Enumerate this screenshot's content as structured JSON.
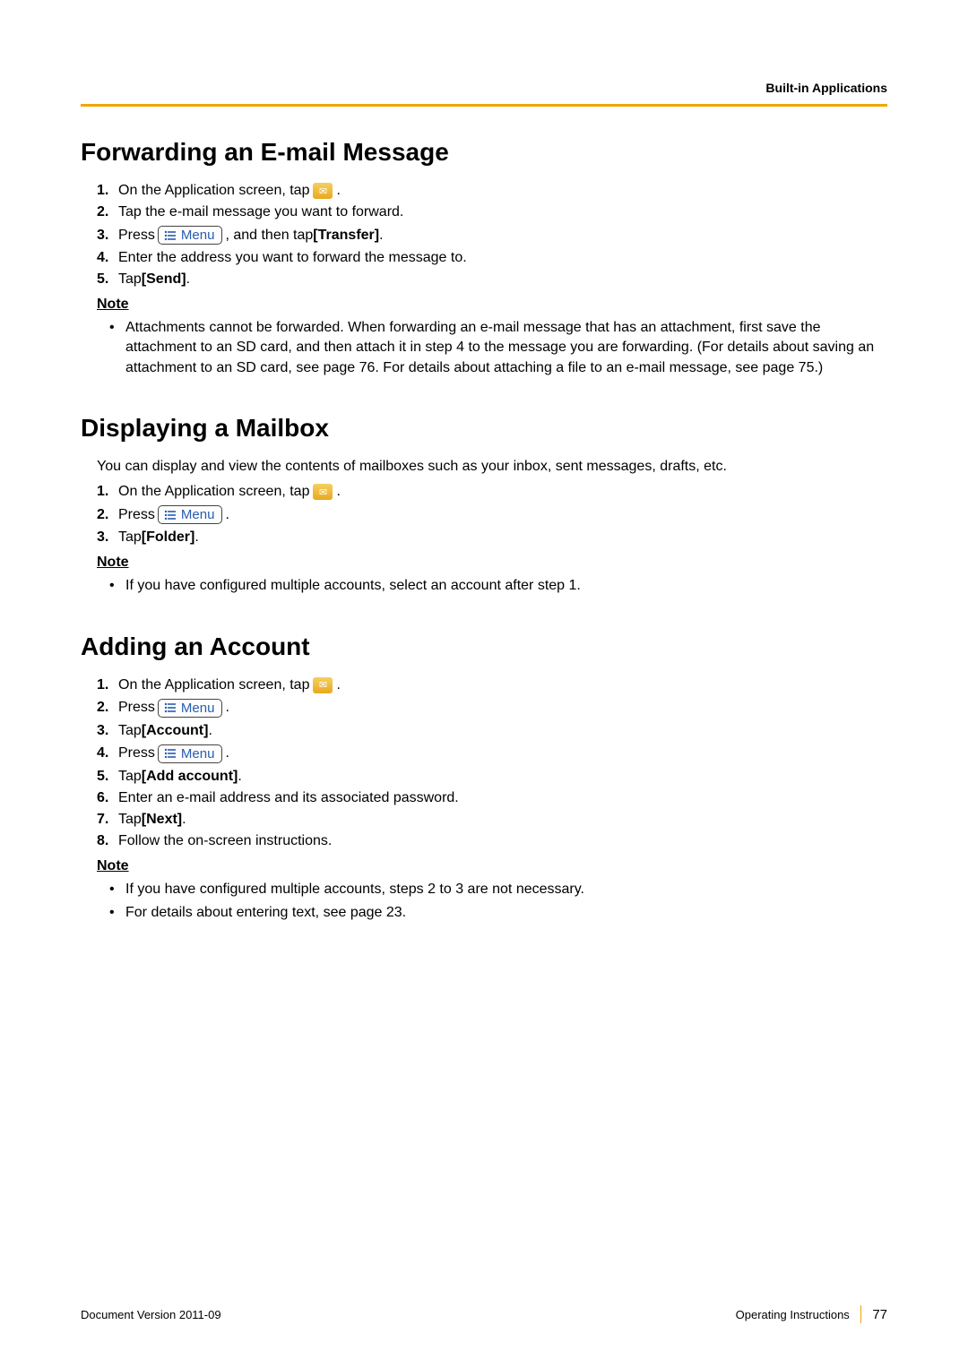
{
  "header": {
    "section": "Built-in Applications"
  },
  "section1": {
    "title": "Forwarding an E-mail Message",
    "steps": [
      {
        "n": "1.",
        "a": "On the Application screen, tap",
        "b": "."
      },
      {
        "n": "2.",
        "a": "Tap the e-mail message you want to forward."
      },
      {
        "n": "3.",
        "a": "Press",
        "b": ", and then tap ",
        "c": "[Transfer]",
        "d": "."
      },
      {
        "n": "4.",
        "a": "Enter the address you want to forward the message to."
      },
      {
        "n": "5.",
        "a": "Tap ",
        "b": "[Send]",
        "c": "."
      }
    ],
    "note_label": "Note",
    "note": "Attachments cannot be forwarded. When forwarding an e-mail message that has an attachment, first save the attachment to an SD card, and then attach it in step 4 to the message you are forwarding. (For details about saving an attachment to an SD card, see page 76. For details about attaching a file to an e-mail message, see page 75.)"
  },
  "section2": {
    "title": "Displaying a Mailbox",
    "intro": "You can display and view the contents of mailboxes such as your inbox, sent messages, drafts, etc.",
    "steps": [
      {
        "n": "1.",
        "a": "On the Application screen, tap",
        "b": "."
      },
      {
        "n": "2.",
        "a": "Press",
        "b": "."
      },
      {
        "n": "3.",
        "a": "Tap ",
        "b": "[Folder]",
        "c": "."
      }
    ],
    "note_label": "Note",
    "note": "If you have configured multiple accounts, select an account after step 1."
  },
  "section3": {
    "title": "Adding an Account",
    "steps": [
      {
        "n": "1.",
        "a": "On the Application screen, tap",
        "b": "."
      },
      {
        "n": "2.",
        "a": "Press",
        "b": "."
      },
      {
        "n": "3.",
        "a": "Tap ",
        "b": "[Account]",
        "c": "."
      },
      {
        "n": "4.",
        "a": "Press",
        "b": "."
      },
      {
        "n": "5.",
        "a": "Tap ",
        "b": "[Add account]",
        "c": "."
      },
      {
        "n": "6.",
        "a": "Enter an e-mail address and its associated password."
      },
      {
        "n": "7.",
        "a": "Tap ",
        "b": "[Next]",
        "c": "."
      },
      {
        "n": "8.",
        "a": "Follow the on-screen instructions."
      }
    ],
    "note_label": "Note",
    "notes": [
      "If you have configured multiple accounts, steps 2 to 3 are not necessary.",
      "For details about entering text, see page 23."
    ]
  },
  "menu_label": "Menu",
  "footer": {
    "left": "Document Version  2011-09",
    "right_label": "Operating Instructions",
    "page": "77"
  }
}
